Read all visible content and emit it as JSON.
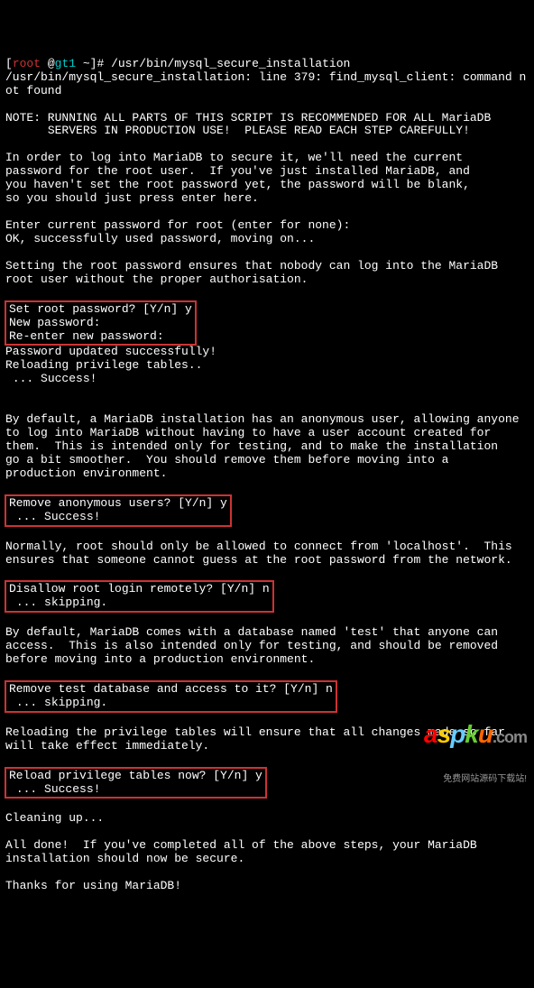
{
  "prompt": {
    "user": "root",
    "at": " @",
    "host": "gt1",
    "path": " ~",
    "delim": "]# ",
    "command": "/usr/bin/mysql_secure_installation"
  },
  "lines": {
    "err": "/usr/bin/mysql_secure_installation: line 379: find_mysql_client: command not found",
    "note1": "NOTE: RUNNING ALL PARTS OF THIS SCRIPT IS RECOMMENDED FOR ALL MariaDB",
    "note2": "      SERVERS IN PRODUCTION USE!  PLEASE READ EACH STEP CAREFULLY!",
    "intro1": "In order to log into MariaDB to secure it, we'll need the current",
    "intro2": "password for the root user.  If you've just installed MariaDB, and",
    "intro3": "you haven't set the root password yet, the password will be blank,",
    "intro4": "so you should just press enter here.",
    "enter_pw": "Enter current password for root (enter for none):",
    "ok_pw": "OK, successfully used password, moving on...",
    "set1": "Setting the root password ensures that nobody can log into the MariaDB",
    "set2": "root user without the proper authorisation.",
    "box1a": "Set root password? [Y/n] y",
    "box1b": "New password:",
    "box1c": "Re-enter new password:",
    "after1a": "Password updated successfully!",
    "after1b": "Reloading privilege tables..",
    "after1c": " ... Success!",
    "anon1": "By default, a MariaDB installation has an anonymous user, allowing anyone",
    "anon2": "to log into MariaDB without having to have a user account created for",
    "anon3": "them.  This is intended only for testing, and to make the installation",
    "anon4": "go a bit smoother.  You should remove them before moving into a",
    "anon5": "production environment.",
    "box2a": "Remove anonymous users? [Y/n] y",
    "box2b": " ... Success!",
    "norm1": "Normally, root should only be allowed to connect from 'localhost'.  This",
    "norm2": "ensures that someone cannot guess at the root password from the network.",
    "box3a": "Disallow root login remotely? [Y/n] n",
    "box3b": " ... skipping.",
    "test1": "By default, MariaDB comes with a database named 'test' that anyone can",
    "test2": "access.  This is also intended only for testing, and should be removed",
    "test3": "before moving into a production environment.",
    "box4a": "Remove test database and access to it? [Y/n] n",
    "box4b": " ... skipping.",
    "reload1": "Reloading the privilege tables will ensure that all changes made so far",
    "reload2": "will take effect immediately.",
    "box5a": "Reload privilege tables now? [Y/n] y",
    "box5b": " ... Success!",
    "cleanup": "Cleaning up...",
    "done1": "All done!  If you've completed all of the above steps, your MariaDB",
    "done2": "installation should now be secure.",
    "thanks": "Thanks for using MariaDB!"
  },
  "watermark": {
    "brand": "aspku",
    "suffix": ".com",
    "tagline": "免费网站源码下载站!"
  }
}
